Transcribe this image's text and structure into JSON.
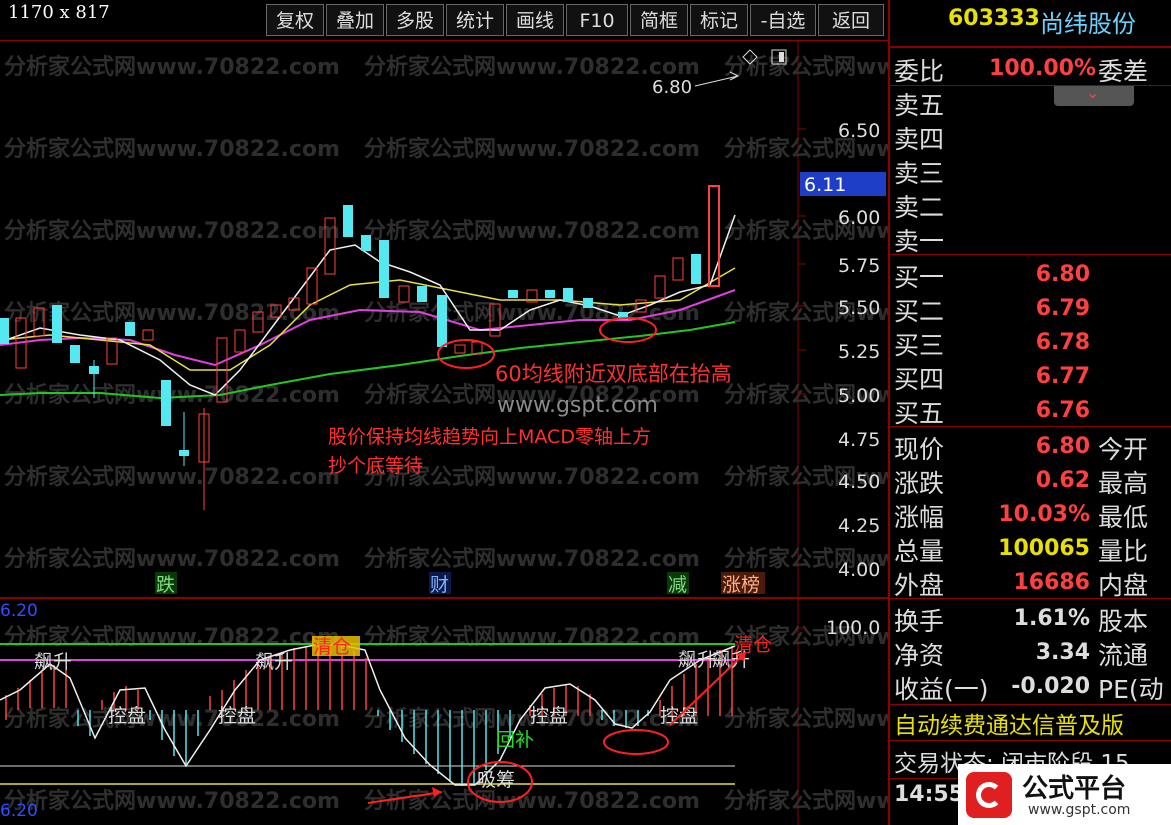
{
  "screenshot_size_label": "1170 x 817",
  "menu": [
    "复权",
    "叠加",
    "多股",
    "统计",
    "画线",
    "F10",
    "简框",
    "标记",
    "-自选",
    "返回"
  ],
  "stock": {
    "code": "603333",
    "name": "尚纬股份"
  },
  "header_marker": "6.80",
  "price_axis": [
    "6.50",
    "6.25",
    "6.00",
    "5.75",
    "5.50",
    "5.25",
    "5.00",
    "4.75",
    "4.50",
    "4.25",
    "4.00"
  ],
  "current_price_tag": "6.11",
  "event_badges": [
    "跌",
    "财",
    "减",
    "涨榜"
  ],
  "watermarks": [
    "分析家公式网www.70822.com"
  ],
  "annotations": {
    "double_bottom": "60均线附近双底部在抬高",
    "site": "www.gspt.com",
    "note_line1": "股价保持均线趋势向上MACD零轴上方",
    "note_line2": "抄个底等待"
  },
  "indicator": {
    "top_label": "6.20",
    "bottom_label": "6.20",
    "axis_value": "100.0",
    "signals": [
      "飙升",
      "飙升",
      "清仓",
      "控盘",
      "控盘",
      "回补",
      "吸筹",
      "控盘",
      "控盘",
      "飙升",
      "飙升",
      "清仓"
    ]
  },
  "orderbook": {
    "ratio_label": "委比",
    "ratio_value": "100.00%",
    "diff_label": "委差",
    "asks": [
      {
        "label": "卖五"
      },
      {
        "label": "卖四"
      },
      {
        "label": "卖三"
      },
      {
        "label": "卖二"
      },
      {
        "label": "卖一"
      }
    ],
    "bids": [
      {
        "label": "买一",
        "price": "6.80"
      },
      {
        "label": "买二",
        "price": "6.79"
      },
      {
        "label": "买三",
        "price": "6.78"
      },
      {
        "label": "买四",
        "price": "6.77"
      },
      {
        "label": "买五",
        "price": "6.76"
      }
    ]
  },
  "quote": [
    {
      "l": "现价",
      "v": "6.80",
      "r": "今开",
      "c": "#ff4040"
    },
    {
      "l": "涨跌",
      "v": "0.62",
      "r": "最高",
      "c": "#ff4040"
    },
    {
      "l": "涨幅",
      "v": "10.03%",
      "r": "最低",
      "c": "#ff4040"
    },
    {
      "l": "总量",
      "v": "100065",
      "r": "量比",
      "c": "#e8e000"
    },
    {
      "l": "外盘",
      "v": "16686",
      "r": "内盘",
      "c": "#ff4040"
    }
  ],
  "quote2": [
    {
      "l": "换手",
      "v": "1.61%",
      "r": "股本",
      "c": "#ddd"
    },
    {
      "l": "净资",
      "v": "3.34",
      "r": "流通",
      "c": "#ddd"
    },
    {
      "l": "收益(一)",
      "v": "-0.020",
      "r": "PE(动",
      "c": "#ddd"
    }
  ],
  "marquee": "自动续费通达信普及版",
  "trade_state": "交易状态: 闭市阶段 15",
  "clock": "14:55",
  "logo": {
    "text": "公式平台",
    "url": "www.gspt.com"
  }
}
